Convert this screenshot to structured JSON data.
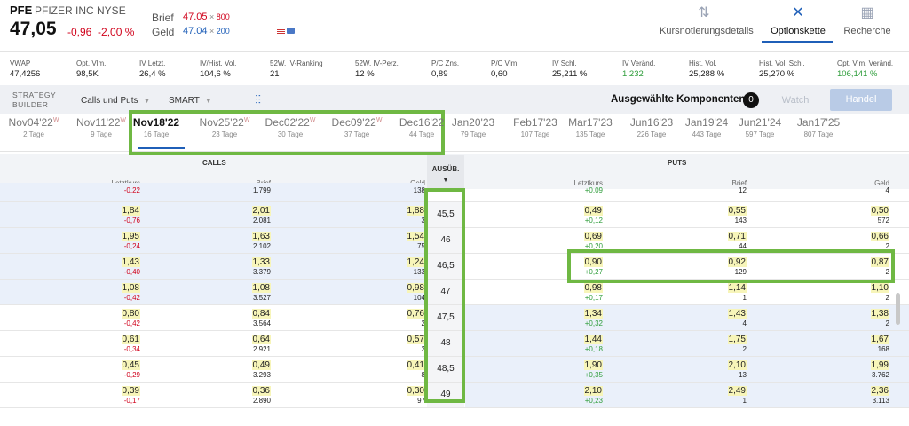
{
  "ticker": {
    "symbol": "PFE",
    "name": "PFIZER INC",
    "exchange": "NYSE",
    "price": "47,05",
    "change": "-0,96",
    "change_pct": "-2,00 %",
    "brief_label": "Brief",
    "brief_price": "47.05",
    "brief_size": "800",
    "geld_label": "Geld",
    "geld_price": "47.04",
    "geld_size": "200"
  },
  "nav": [
    {
      "label": "Kursnotierungsdetails",
      "icon": "sort-arrows-icon"
    },
    {
      "label": "Optionskette",
      "icon": "cross-icon"
    },
    {
      "label": "Recherche",
      "icon": "building-icon"
    }
  ],
  "stats": [
    {
      "label": "VWAP",
      "value": "47,4256",
      "color": "#222222"
    },
    {
      "label": "Opt. Vlm.",
      "value": "98,5K",
      "color": "#222222"
    },
    {
      "label": "IV Letzt.",
      "value": "26,4 %",
      "color": "#222222"
    },
    {
      "label": "IV/Hist. Vol.",
      "value": "104,6 %",
      "color": "#222222"
    },
    {
      "label": "52W. IV-Ranking",
      "value": "21",
      "color": "#222222"
    },
    {
      "label": "52W. IV-Perz.",
      "value": "12 %",
      "color": "#222222"
    },
    {
      "label": "P/C Zns.",
      "value": "0,89",
      "color": "#222222"
    },
    {
      "label": "P/C Vlm.",
      "value": "0,60",
      "color": "#222222"
    },
    {
      "label": "IV Schl.",
      "value": "25,211 %",
      "color": "#222222"
    },
    {
      "label": "IV Veränd.",
      "value": "1,232",
      "color": "#2e9d3a"
    },
    {
      "label": "Hist. Vol.",
      "value": "25,288 %",
      "color": "#222222"
    },
    {
      "label": "Hist. Vol. Schl.",
      "value": "25,270 %",
      "color": "#222222"
    },
    {
      "label": "Opt. Vlm. Veränd.",
      "value": "106,141 %",
      "color": "#2e9d3a"
    }
  ],
  "strategy": {
    "title_line1": "STRATEGY",
    "title_line2": "BUILDER",
    "type": "Calls und Puts",
    "exchange": "SMART",
    "selected_label": "Ausgewählte Komponenten",
    "selected_count": "0",
    "watch": "Watch",
    "trade": "Handel"
  },
  "expiries": [
    {
      "date": "Nov04'22",
      "w": "W",
      "days": "2 Tage"
    },
    {
      "date": "Nov11'22",
      "w": "W",
      "days": "9 Tage"
    },
    {
      "date": "Nov18'22",
      "w": "",
      "days": "16 Tage"
    },
    {
      "date": "Nov25'22",
      "w": "W",
      "days": "23 Tage"
    },
    {
      "date": "Dec02'22",
      "w": "W",
      "days": "30 Tage"
    },
    {
      "date": "Dec09'22",
      "w": "W",
      "days": "37 Tage"
    },
    {
      "date": "Dec16'22",
      "w": "",
      "days": "44 Tage"
    },
    {
      "date": "Jan20'23",
      "w": "",
      "days": "79 Tage"
    },
    {
      "date": "Feb17'23",
      "w": "",
      "days": "107 Tage"
    },
    {
      "date": "Mar17'23",
      "w": "",
      "days": "135 Tage"
    },
    {
      "date": "Jun16'23",
      "w": "",
      "days": "226 Tage"
    },
    {
      "date": "Jan19'24",
      "w": "",
      "days": "443 Tage"
    },
    {
      "date": "Jun21'24",
      "w": "",
      "days": "597 Tage"
    },
    {
      "date": "Jan17'25",
      "w": "",
      "days": "807 Tage"
    }
  ],
  "table": {
    "calls": "CALLS",
    "puts": "PUTS",
    "strike_header": "AUSÜB.",
    "col_last": "Letztkurs",
    "col_ask": "Brief",
    "col_bid": "Geld",
    "rows": [
      {
        "c_last": "",
        "c_chg": "-0,22",
        "c_ask": "",
        "c_asz": "1.799",
        "c_bid": "",
        "c_bsz": "138",
        "strike": "",
        "p_last": "",
        "p_chg": "+0,09",
        "p_ask": "",
        "p_asz": "12",
        "p_bid": "",
        "p_bsz": "4"
      },
      {
        "c_last": "1,84",
        "c_chg": "-0,76",
        "c_ask": "2,01",
        "c_asz": "2.081",
        "c_bid": "1,88",
        "c_bsz": "3",
        "strike": "45,5",
        "p_last": "0,49",
        "p_chg": "+0,12",
        "p_ask": "0,55",
        "p_asz": "143",
        "p_bid": "0,50",
        "p_bsz": "572"
      },
      {
        "c_last": "1,95",
        "c_chg": "-0,24",
        "c_ask": "1,63",
        "c_asz": "2.102",
        "c_bid": "1,54",
        "c_bsz": "75",
        "strike": "46",
        "p_last": "0,69",
        "p_chg": "+0,20",
        "p_ask": "0,71",
        "p_asz": "44",
        "p_bid": "0,66",
        "p_bsz": "2"
      },
      {
        "c_last": "1,43",
        "c_chg": "-0,40",
        "c_ask": "1,33",
        "c_asz": "3.379",
        "c_bid": "1,24",
        "c_bsz": "133",
        "strike": "46,5",
        "p_last": "0,90",
        "p_chg": "+0,27",
        "p_ask": "0,92",
        "p_asz": "129",
        "p_bid": "0,87",
        "p_bsz": "2"
      },
      {
        "c_last": "1,08",
        "c_chg": "-0,42",
        "c_ask": "1,08",
        "c_asz": "3.527",
        "c_bid": "0,98",
        "c_bsz": "104",
        "strike": "47",
        "p_last": "0,98",
        "p_chg": "+0,17",
        "p_ask": "1,14",
        "p_asz": "1",
        "p_bid": "1,10",
        "p_bsz": "2"
      },
      {
        "c_last": "0,80",
        "c_chg": "-0,42",
        "c_ask": "0,84",
        "c_asz": "3.564",
        "c_bid": "0,76",
        "c_bsz": "2",
        "strike": "47,5",
        "p_last": "1,34",
        "p_chg": "+0,32",
        "p_ask": "1,43",
        "p_asz": "4",
        "p_bid": "1,38",
        "p_bsz": "2"
      },
      {
        "c_last": "0,61",
        "c_chg": "-0,34",
        "c_ask": "0,64",
        "c_asz": "2.921",
        "c_bid": "0,57",
        "c_bsz": "2",
        "strike": "48",
        "p_last": "1,44",
        "p_chg": "+0,18",
        "p_ask": "1,75",
        "p_asz": "2",
        "p_bid": "1,67",
        "p_bsz": "168"
      },
      {
        "c_last": "0,45",
        "c_chg": "-0,29",
        "c_ask": "0,49",
        "c_asz": "3.293",
        "c_bid": "0,41",
        "c_bsz": "8",
        "strike": "48,5",
        "p_last": "1,90",
        "p_chg": "+0,35",
        "p_ask": "2,10",
        "p_asz": "13",
        "p_bid": "1,99",
        "p_bsz": "3.762"
      },
      {
        "c_last": "0,39",
        "c_chg": "-0,17",
        "c_ask": "0,36",
        "c_asz": "2.890",
        "c_bid": "0,30",
        "c_bsz": "97",
        "strike": "49",
        "p_last": "2,10",
        "p_chg": "+0,23",
        "p_ask": "2,49",
        "p_asz": "1",
        "p_bid": "2,36",
        "p_bsz": "3.113"
      }
    ]
  }
}
